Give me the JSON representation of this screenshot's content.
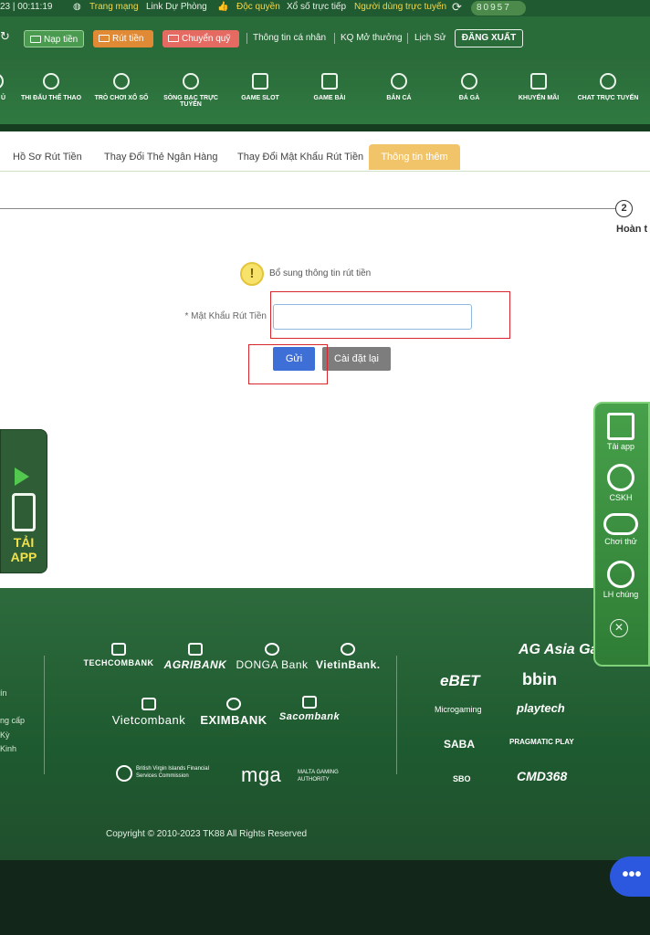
{
  "topbar": {
    "time": "23 | 00:11:19",
    "network": "Trang mạng",
    "backup_link": "Link Dự Phòng",
    "exclusive": "Độc quyền",
    "lottery_live": "Xổ số trực tiếp",
    "users_online": "Người dùng trực tuyến",
    "online_count": "80957"
  },
  "actions": {
    "deposit": "Nạp tiền",
    "withdraw": "Rút tiền",
    "transfer": "Chuyển quỹ",
    "links": [
      "Thông tin cá nhân",
      "KQ Mở thưởng",
      "Lịch Sử"
    ],
    "logout": "ĐĂNG XUẤT"
  },
  "main_nav": [
    {
      "label": "THI ĐẤU THỂ THAO",
      "icon": "soccer-ball-icon"
    },
    {
      "label": "TRÒ CHƠI XỔ SỐ",
      "icon": "lottery-ball-icon"
    },
    {
      "label": "SÒNG BẠC TRỰC TUYẾN",
      "icon": "casino-chip-icon"
    },
    {
      "label": "GAME SLOT",
      "icon": "slot-machine-icon"
    },
    {
      "label": "GAME BÀI",
      "icon": "cards-icon"
    },
    {
      "label": "BẮN CÁ",
      "icon": "fish-icon"
    },
    {
      "label": "ĐÁ GÀ",
      "icon": "rooster-icon"
    },
    {
      "label": "KHUYẾN MÃI",
      "icon": "gift-icon"
    },
    {
      "label": "CHAT TRỰC TUYẾN",
      "icon": "chat-icon"
    }
  ],
  "tabs": {
    "items": [
      "Hồ Sơ Rút Tiền",
      "Thay Đổi Thẻ Ngân Hàng",
      "Thay Đổi Mật Khẩu Rút Tiền"
    ],
    "active": "Thông tin thêm"
  },
  "step": {
    "number": "2",
    "label": "Hoàn t"
  },
  "form": {
    "notice": "Bổ sung thông tin rút tiền",
    "password_label": "* Mật Khẩu Rút Tiền",
    "password_value": "",
    "submit": "Gửi",
    "reset": "Cài đặt lại"
  },
  "left_float": {
    "label": "TẢI APP"
  },
  "right_float": [
    {
      "label": "Tải app",
      "icon": "download-icon"
    },
    {
      "label": "CSKH",
      "icon": "headset-icon"
    },
    {
      "label": "Chơi thử",
      "icon": "gamepad-icon"
    },
    {
      "label": "LH chúng",
      "icon": "phone-icon"
    }
  ],
  "footer": {
    "left_links": [
      "ín",
      "ng cấp",
      "Kỳ",
      "Kinh"
    ],
    "banks": [
      "TECHCOMBANK",
      "AGRIBANK",
      "DONGA Bank",
      "VietinBank.",
      "Vietcombank",
      "EXIMBANK",
      "Sacombank"
    ],
    "regulators": [
      "British Virgin Islands Financial Services Commission",
      "mga",
      "MALTA GAMING AUTHORITY"
    ],
    "providers": [
      "AG Asia Gaming",
      "eBET",
      "bbin",
      "Microgaming",
      "playtech",
      "SABA",
      "PRAGMATIC PLAY",
      "SBO",
      "CMD368"
    ],
    "copyright": "Copyright © 2010-2023 TK88 All Rights Reserved"
  },
  "chat_bubble": "•••",
  "colors": {
    "header_green": "#2a6b3a",
    "active_tab": "#f2c46a",
    "submit_blue": "#3d6fd6",
    "reset_gray": "#7d7d7d",
    "highlight_red": "#d9262c"
  }
}
